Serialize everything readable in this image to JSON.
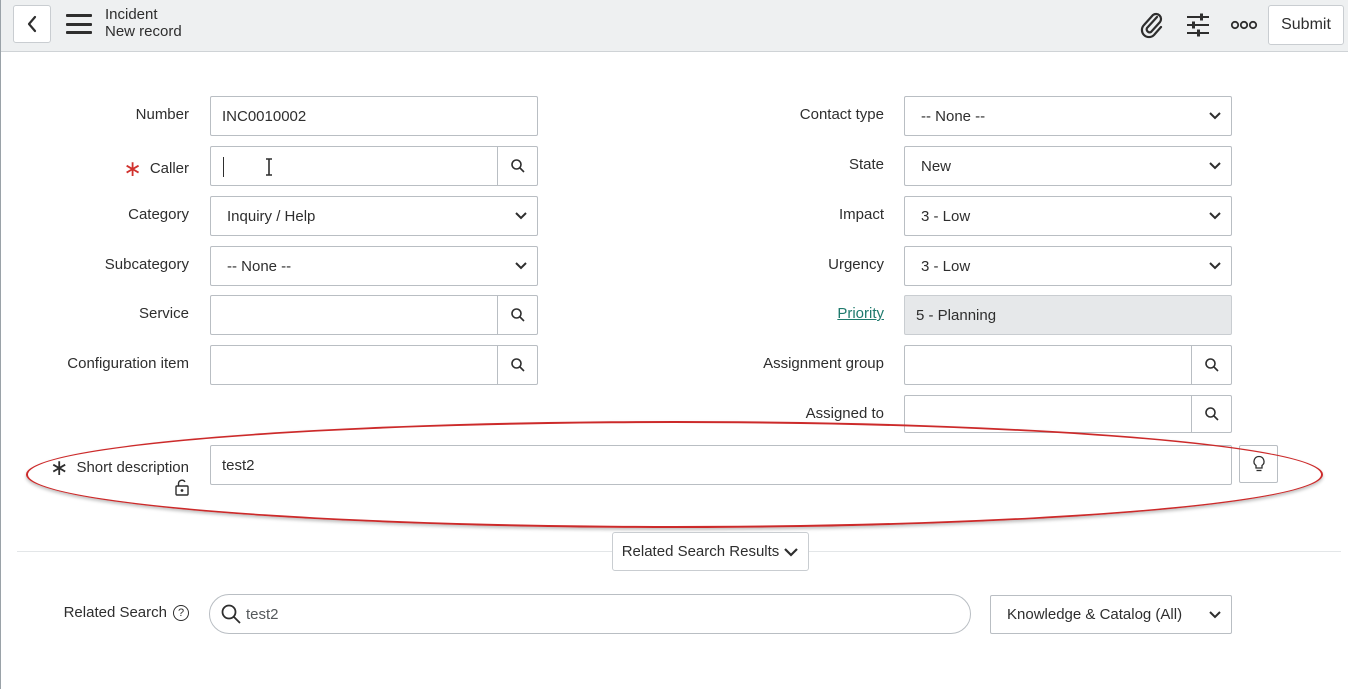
{
  "header": {
    "title": "Incident",
    "subtitle": "New record",
    "submit_label": "Submit",
    "icons": [
      "back-chevron-icon",
      "menu-icon",
      "paperclip-icon",
      "settings-sliders-icon",
      "more-options-icon"
    ]
  },
  "form": {
    "number": {
      "label": "Number",
      "value": "INC0010002"
    },
    "caller": {
      "label": "Caller",
      "value": "",
      "required": true
    },
    "category": {
      "label": "Category",
      "value": "Inquiry / Help"
    },
    "subcategory": {
      "label": "Subcategory",
      "value": "-- None --"
    },
    "service": {
      "label": "Service",
      "value": ""
    },
    "configuration_item": {
      "label": "Configuration item",
      "value": ""
    },
    "contact_type": {
      "label": "Contact type",
      "value": "-- None --"
    },
    "state": {
      "label": "State",
      "value": "New"
    },
    "impact": {
      "label": "Impact",
      "value": "3 - Low"
    },
    "urgency": {
      "label": "Urgency",
      "value": "3 - Low"
    },
    "priority": {
      "label": "Priority",
      "value": "5 - Planning"
    },
    "assignment_group": {
      "label": "Assignment group",
      "value": ""
    },
    "assigned_to": {
      "label": "Assigned to",
      "value": ""
    },
    "short_description": {
      "label": "Short description",
      "value": "test2",
      "required": true
    }
  },
  "related": {
    "results_button": "Related Search Results",
    "search_label": "Related Search",
    "help_glyph": "?",
    "search_value": "test2",
    "scope_value": "Knowledge & Catalog (All)"
  },
  "colors": {
    "required_star": "#d0312d",
    "priority_link": "#1f7a6d",
    "highlight_oval": "#cc2a2a"
  }
}
